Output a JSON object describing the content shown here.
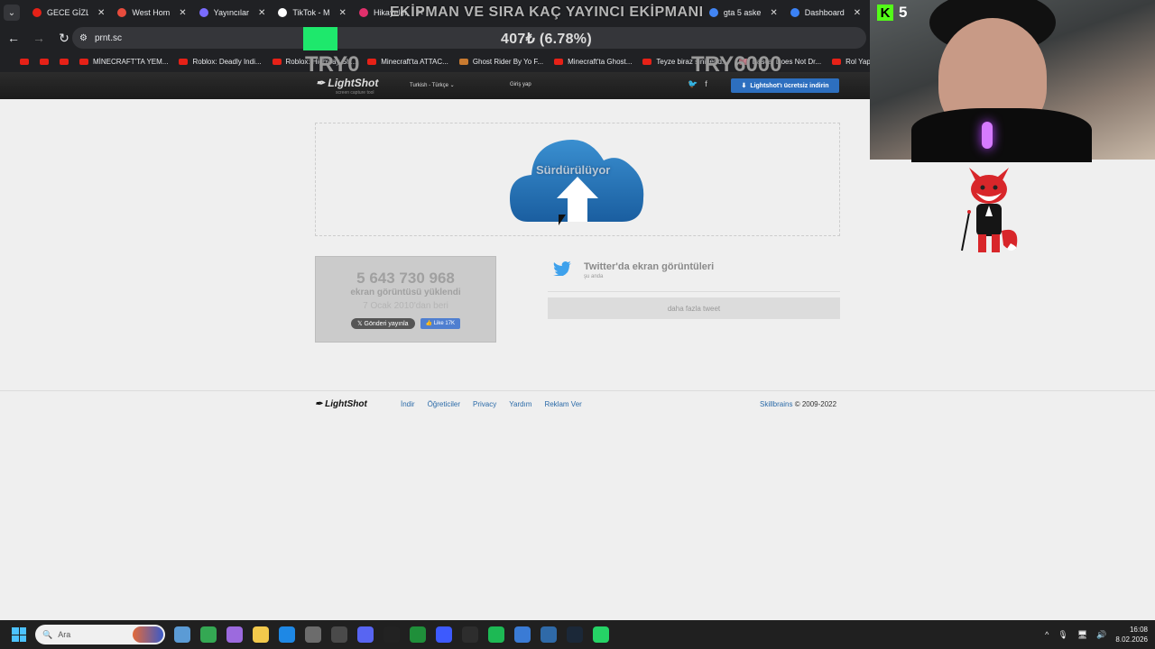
{
  "browser": {
    "tabs": [
      {
        "title": "GECE GİZLİ",
        "color": "#e62117"
      },
      {
        "title": "West Hom",
        "color": "#e84c3d"
      },
      {
        "title": "Yayıncılar",
        "color": "#7a6cff"
      },
      {
        "title": "TikTok - M",
        "color": "#ffffff"
      },
      {
        "title": "Hikayeler",
        "color": "#e1306c"
      },
      {
        "title": "gta 5 aske",
        "color": "#4285f4"
      },
      {
        "title": "Dashboard",
        "color": "#3b82f6"
      }
    ],
    "overlay_title": "EKİPMAN VE SIRA KAÇ YAYINCI EKİPMANI",
    "url": "prnt.sc",
    "percent_overlay": "407₺ (6.78%)",
    "bookmarks": [
      "",
      "",
      "",
      "MİNECRAFT'TA YEM...",
      "Roblox: Deadly Indi...",
      "Roblox: Highway Sh...",
      "Minecraft'ta ATTAC...",
      "Ghost Rider By Yo F...",
      "Minecraft'ta Ghost...",
      "Teyze biraz sinirlend...",
      "Bascal Does Not Dr...",
      "Rol Yap"
    ],
    "try_left": "TRY0",
    "try_right": "TRY6000"
  },
  "lightshot": {
    "logo": "LightShot",
    "logo_sub": "screen capture tool",
    "language": "Turkish - Türkçe",
    "login": "Giriş yap",
    "download_button": "Lightshot'ı ücretsiz indirin",
    "upload_status": "Sürdürülüyor",
    "stats": {
      "count": "5 643 730 968",
      "label": "ekran görüntüsü yüklendi",
      "since": "7 Ocak 2010'dan beri",
      "post_button": "Gönderi yayınla",
      "like_button": "Like 17K"
    },
    "twitter": {
      "title": "Twitter'da ekran görüntüleri",
      "subtitle": "şu anda",
      "more": "daha fazla tweet"
    },
    "footer": {
      "logo": "LightShot",
      "links": [
        "İndir",
        "Öğreticiler",
        "Privacy",
        "Yardım",
        "Reklam Ver"
      ],
      "company": "Skillbrains",
      "copyright": "© 2009-2022"
    }
  },
  "stream": {
    "kick_count": "5"
  },
  "taskbar": {
    "search_placeholder": "Ara",
    "time": "16:08",
    "date": "8.02.2026",
    "app_colors": [
      "#5b9bd5",
      "#34a853",
      "#9c6ade",
      "#f2c94c",
      "#1e88e5",
      "#6c6c6c",
      "#4a4a4a",
      "#5865f2",
      "#222222",
      "#1f8f3a",
      "#3d5afe",
      "#2d2d2d",
      "#1db954",
      "#3a7bd5",
      "#2f6aa8",
      "#1b2838",
      "#25d366"
    ]
  }
}
